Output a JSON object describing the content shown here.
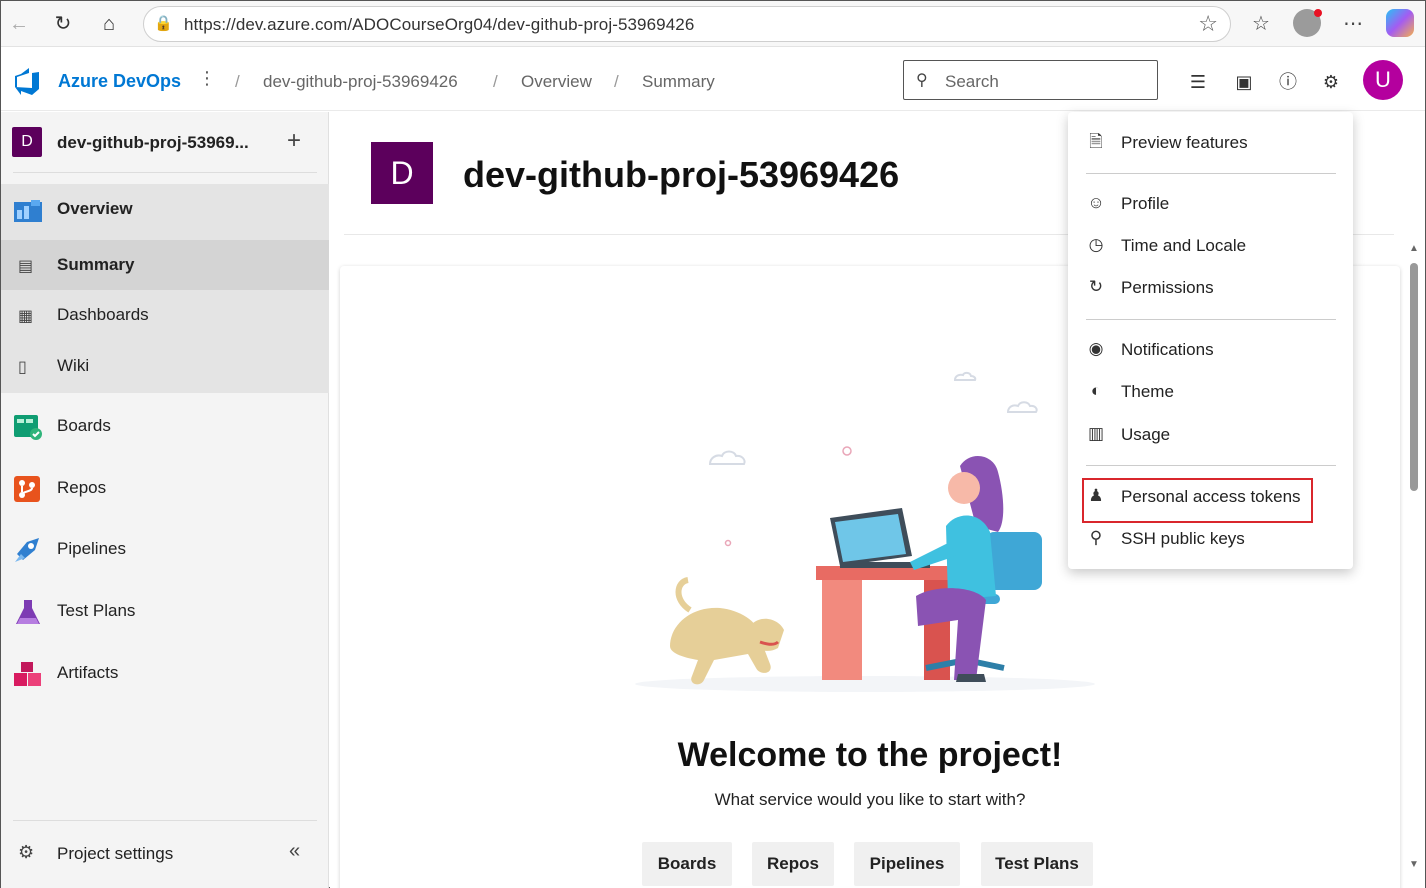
{
  "browser": {
    "url": "https://dev.azure.com/ADOCourseOrg04/dev-github-proj-53969426",
    "icons": [
      "back-arrow-icon",
      "refresh-icon",
      "home-icon",
      "lock-icon",
      "star-icon",
      "favorites-icon",
      "profile-icon",
      "more-icon",
      "copilot-icon"
    ]
  },
  "header": {
    "brand": "Azure DevOps",
    "breadcrumb": [
      "dev-github-proj-53969426",
      "Overview",
      "Summary"
    ],
    "search_placeholder": "Search",
    "user_initial": "U",
    "colors": {
      "brand": "#0078d4",
      "avatar": "#b4009e"
    }
  },
  "sidebar": {
    "project_initial": "D",
    "project_name": "dev-github-proj-53969...",
    "items": [
      {
        "label": "Overview",
        "icon": "overview-icon"
      },
      {
        "label": "Summary",
        "icon": "summary-icon"
      },
      {
        "label": "Dashboards",
        "icon": "dashboards-icon"
      },
      {
        "label": "Wiki",
        "icon": "wiki-icon"
      },
      {
        "label": "Boards",
        "icon": "boards-icon"
      },
      {
        "label": "Repos",
        "icon": "repos-icon"
      },
      {
        "label": "Pipelines",
        "icon": "pipelines-icon"
      },
      {
        "label": "Test Plans",
        "icon": "test-plans-icon"
      },
      {
        "label": "Artifacts",
        "icon": "artifacts-icon"
      }
    ],
    "settings_label": "Project settings"
  },
  "main": {
    "project_initial": "D",
    "project_title": "dev-github-proj-53969426",
    "welcome_title": "Welcome to the project!",
    "welcome_subtitle": "What service would you like to start with?",
    "services": [
      "Boards",
      "Repos",
      "Pipelines",
      "Test Plans"
    ]
  },
  "menu": {
    "items": [
      {
        "label": "Preview features",
        "icon": "document-icon"
      },
      {
        "label": "Profile",
        "icon": "profile-icon"
      },
      {
        "label": "Time and Locale",
        "icon": "globe-clock-icon"
      },
      {
        "label": "Permissions",
        "icon": "refresh-icon"
      },
      {
        "label": "Notifications",
        "icon": "notification-icon"
      },
      {
        "label": "Theme",
        "icon": "theme-icon"
      },
      {
        "label": "Usage",
        "icon": "chart-icon"
      },
      {
        "label": "Personal access tokens",
        "icon": "person-key-icon"
      },
      {
        "label": "SSH public keys",
        "icon": "key-icon"
      }
    ],
    "highlighted": "Personal access tokens",
    "highlight_color": "#d9262c"
  }
}
